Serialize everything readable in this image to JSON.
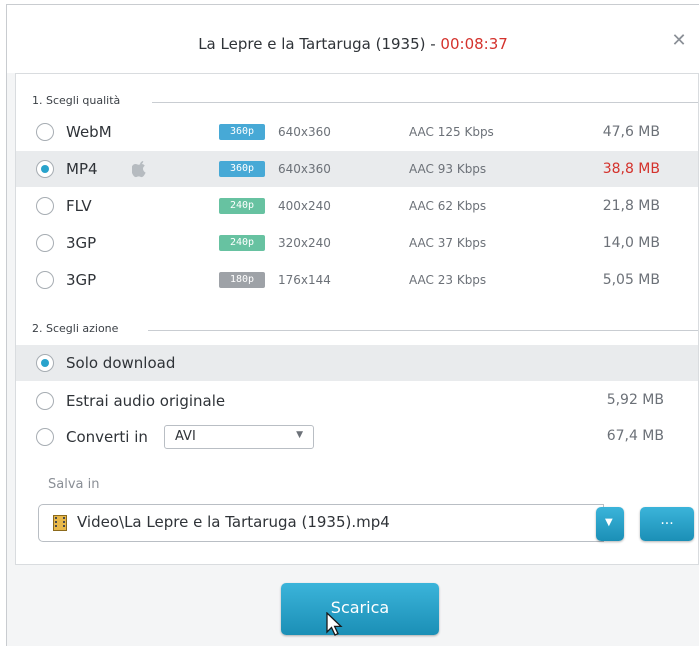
{
  "window": {
    "title": "La Lepre e la Tartaruga (1935) - ",
    "duration": "00:08:37"
  },
  "quality": {
    "label": "1. Scegli qualità",
    "rows": [
      {
        "format": "WebM",
        "badge": "360p",
        "resolution": "640x360",
        "audio": "AAC 125  Kbps",
        "size": "47,6 MB",
        "selected": false
      },
      {
        "format": "MP4",
        "badge": "360p",
        "resolution": "640x360",
        "audio": "AAC 93  Kbps",
        "size": "38,8 MB",
        "selected": true,
        "icon": "apple-icon"
      },
      {
        "format": "FLV",
        "badge": "240p",
        "resolution": "400x240",
        "audio": "AAC 62  Kbps",
        "size": "21,8 MB",
        "selected": false
      },
      {
        "format": "3GP",
        "badge": "240p",
        "resolution": "320x240",
        "audio": "AAC 37  Kbps",
        "size": "14,0 MB",
        "selected": false
      },
      {
        "format": "3GP",
        "badge": "180p",
        "resolution": "176x144",
        "audio": "AAC 23  Kbps",
        "size": "5,05 MB",
        "selected": false
      }
    ]
  },
  "action": {
    "label": "2. Scegli azione",
    "only_download": "Solo download",
    "extract_audio": "Estrai audio originale",
    "extract_size": "5,92 MB",
    "convert": "Converti in",
    "convert_format": "AVI",
    "convert_size": "67,4 MB"
  },
  "save": {
    "label": "Salva in",
    "path": "Video\\La Lepre e la Tartaruga (1935).mp4",
    "browse": "..."
  },
  "download_button": "Scarica",
  "colors": {
    "accent": "#29a3cc",
    "highlight": "#d4322c"
  }
}
